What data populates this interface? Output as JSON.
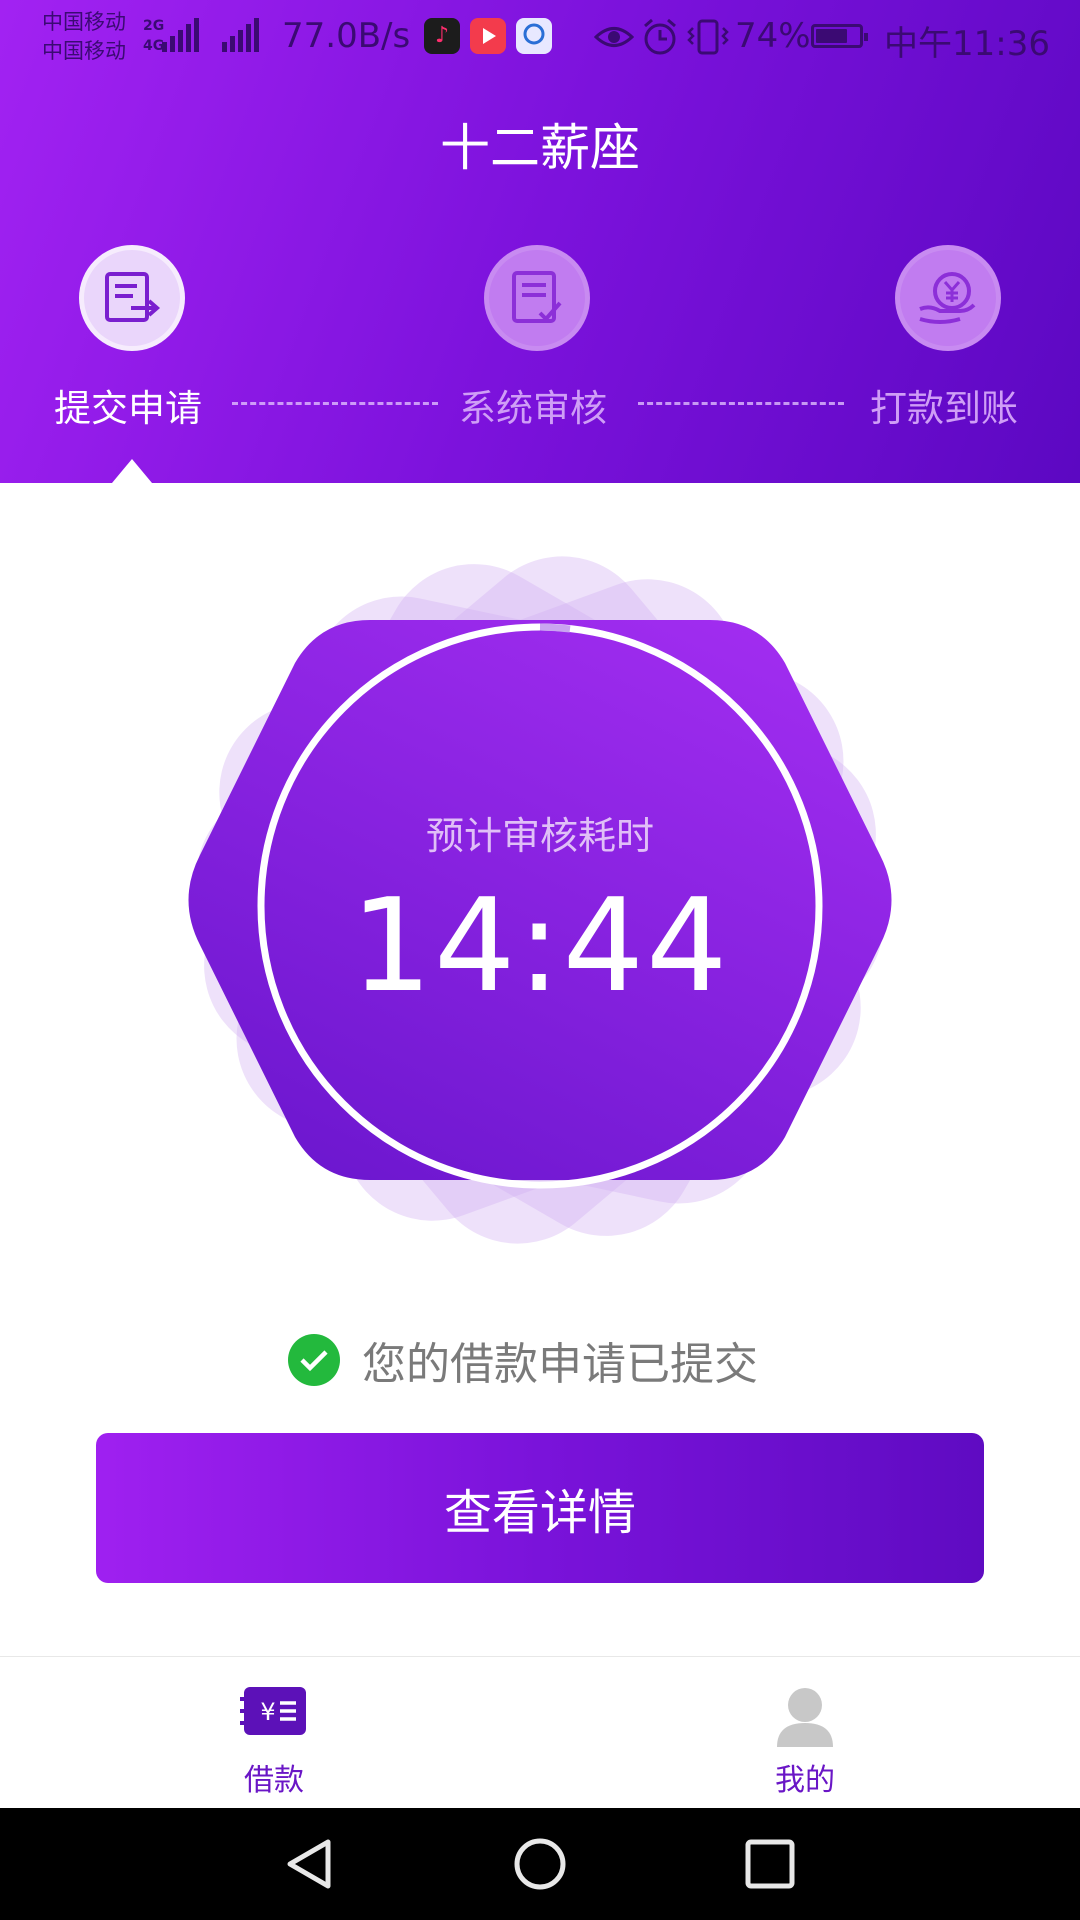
{
  "status_bar": {
    "carrier_1": "中国移动",
    "carrier_2": "中国移动",
    "network_1": "2G",
    "network_2": "4G",
    "net_speed": "77.0B/s",
    "battery_percent": "74%",
    "battery_level": 0.74,
    "time": "中午11:36",
    "icons": [
      "tiktok-app-icon",
      "video-app-icon",
      "china-mobile-app-icon",
      "eye-care-icon",
      "alarm-icon",
      "vibrate-icon",
      "battery-icon"
    ]
  },
  "header": {
    "title": "十二薪座",
    "background_colors": [
      "#a222f2",
      "#5c08c2"
    ]
  },
  "steps": [
    {
      "label": "提交申请",
      "icon": "document-submit-icon",
      "state": "active"
    },
    {
      "label": "系统审核",
      "icon": "document-review-icon",
      "state": "inactive"
    },
    {
      "label": "打款到账",
      "icon": "money-hand-icon",
      "state": "inactive"
    }
  ],
  "timer": {
    "label": "预计审核耗时",
    "value": "14:44"
  },
  "status_message": "您的借款申请已提交",
  "detail_button": "查看详情",
  "bottom_nav": [
    {
      "label": "借款",
      "icon": "loan-card-icon",
      "active": true
    },
    {
      "label": "我的",
      "icon": "person-icon",
      "active": false
    }
  ],
  "system_nav": [
    "back-icon",
    "home-icon",
    "recents-icon"
  ],
  "colors": {
    "accent": "#7a13da",
    "success": "#23b93d",
    "inactive_gray": "#c8c8c8"
  }
}
